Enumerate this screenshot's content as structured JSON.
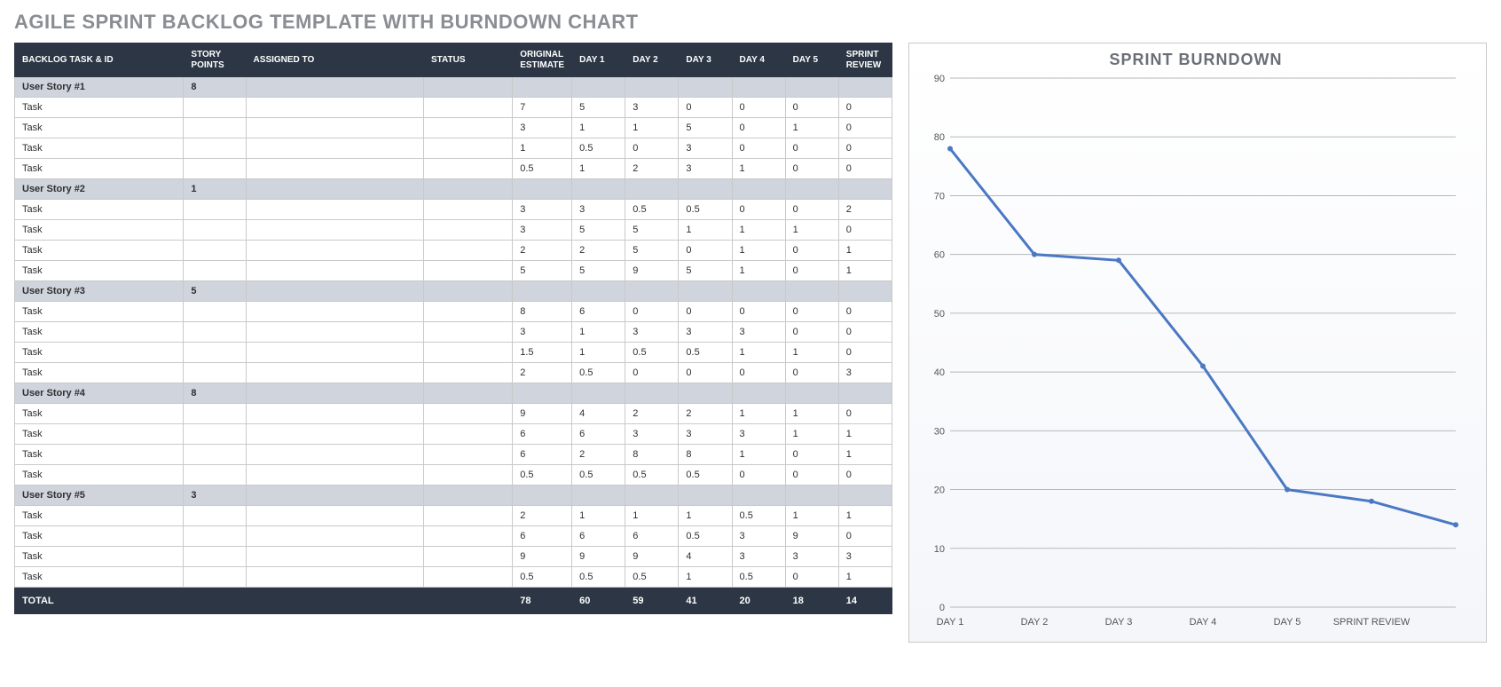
{
  "title": "AGILE SPRINT BACKLOG TEMPLATE WITH BURNDOWN CHART",
  "columns": [
    "BACKLOG TASK & ID",
    "STORY POINTS",
    "ASSIGNED TO",
    "STATUS",
    "ORIGINAL ESTIMATE",
    "DAY 1",
    "DAY 2",
    "DAY 3",
    "DAY 4",
    "DAY 5",
    "SPRINT REVIEW"
  ],
  "rows": [
    {
      "type": "story",
      "cells": [
        "User Story #1",
        "8",
        "",
        "",
        "",
        "",
        "",
        "",
        "",
        "",
        ""
      ]
    },
    {
      "type": "task",
      "cells": [
        "Task",
        "",
        "",
        "",
        "7",
        "5",
        "3",
        "0",
        "0",
        "0",
        "0"
      ]
    },
    {
      "type": "task",
      "cells": [
        "Task",
        "",
        "",
        "",
        "3",
        "1",
        "1",
        "5",
        "0",
        "1",
        "0"
      ]
    },
    {
      "type": "task",
      "cells": [
        "Task",
        "",
        "",
        "",
        "1",
        "0.5",
        "0",
        "3",
        "0",
        "0",
        "0"
      ]
    },
    {
      "type": "task",
      "cells": [
        "Task",
        "",
        "",
        "",
        "0.5",
        "1",
        "2",
        "3",
        "1",
        "0",
        "0"
      ]
    },
    {
      "type": "story",
      "cells": [
        "User Story #2",
        "1",
        "",
        "",
        "",
        "",
        "",
        "",
        "",
        "",
        ""
      ]
    },
    {
      "type": "task",
      "cells": [
        "Task",
        "",
        "",
        "",
        "3",
        "3",
        "0.5",
        "0.5",
        "0",
        "0",
        "2"
      ]
    },
    {
      "type": "task",
      "cells": [
        "Task",
        "",
        "",
        "",
        "3",
        "5",
        "5",
        "1",
        "1",
        "1",
        "0"
      ]
    },
    {
      "type": "task",
      "cells": [
        "Task",
        "",
        "",
        "",
        "2",
        "2",
        "5",
        "0",
        "1",
        "0",
        "1"
      ]
    },
    {
      "type": "task",
      "cells": [
        "Task",
        "",
        "",
        "",
        "5",
        "5",
        "9",
        "5",
        "1",
        "0",
        "1"
      ]
    },
    {
      "type": "story",
      "cells": [
        "User Story #3",
        "5",
        "",
        "",
        "",
        "",
        "",
        "",
        "",
        "",
        ""
      ]
    },
    {
      "type": "task",
      "cells": [
        "Task",
        "",
        "",
        "",
        "8",
        "6",
        "0",
        "0",
        "0",
        "0",
        "0"
      ]
    },
    {
      "type": "task",
      "cells": [
        "Task",
        "",
        "",
        "",
        "3",
        "1",
        "3",
        "3",
        "3",
        "0",
        "0"
      ]
    },
    {
      "type": "task",
      "cells": [
        "Task",
        "",
        "",
        "",
        "1.5",
        "1",
        "0.5",
        "0.5",
        "1",
        "1",
        "0"
      ]
    },
    {
      "type": "task",
      "cells": [
        "Task",
        "",
        "",
        "",
        "2",
        "0.5",
        "0",
        "0",
        "0",
        "0",
        "3"
      ]
    },
    {
      "type": "story",
      "cells": [
        "User Story #4",
        "8",
        "",
        "",
        "",
        "",
        "",
        "",
        "",
        "",
        ""
      ]
    },
    {
      "type": "task",
      "cells": [
        "Task",
        "",
        "",
        "",
        "9",
        "4",
        "2",
        "2",
        "1",
        "1",
        "0"
      ]
    },
    {
      "type": "task",
      "cells": [
        "Task",
        "",
        "",
        "",
        "6",
        "6",
        "3",
        "3",
        "3",
        "1",
        "1"
      ]
    },
    {
      "type": "task",
      "cells": [
        "Task",
        "",
        "",
        "",
        "6",
        "2",
        "8",
        "8",
        "1",
        "0",
        "1"
      ]
    },
    {
      "type": "task",
      "cells": [
        "Task",
        "",
        "",
        "",
        "0.5",
        "0.5",
        "0.5",
        "0.5",
        "0",
        "0",
        "0"
      ]
    },
    {
      "type": "story",
      "cells": [
        "User Story #5",
        "3",
        "",
        "",
        "",
        "",
        "",
        "",
        "",
        "",
        ""
      ]
    },
    {
      "type": "task",
      "cells": [
        "Task",
        "",
        "",
        "",
        "2",
        "1",
        "1",
        "1",
        "0.5",
        "1",
        "1"
      ]
    },
    {
      "type": "task",
      "cells": [
        "Task",
        "",
        "",
        "",
        "6",
        "6",
        "6",
        "0.5",
        "3",
        "9",
        "0"
      ]
    },
    {
      "type": "task",
      "cells": [
        "Task",
        "",
        "",
        "",
        "9",
        "9",
        "9",
        "4",
        "3",
        "3",
        "3"
      ]
    },
    {
      "type": "task",
      "cells": [
        "Task",
        "",
        "",
        "",
        "0.5",
        "0.5",
        "0.5",
        "1",
        "0.5",
        "0",
        "1"
      ]
    },
    {
      "type": "total",
      "cells": [
        "TOTAL",
        "",
        "",
        "",
        "78",
        "60",
        "59",
        "41",
        "20",
        "18",
        "14"
      ]
    }
  ],
  "chart_data": {
    "type": "line",
    "title": "SPRINT BURNDOWN",
    "categories": [
      "DAY 1",
      "DAY 2",
      "DAY 3",
      "DAY 4",
      "DAY 5",
      "SPRINT REVIEW"
    ],
    "values": [
      78,
      60,
      59,
      41,
      20,
      18,
      14
    ],
    "xlabel": "",
    "ylabel": "",
    "ylim": [
      0,
      90
    ],
    "yticks": [
      0,
      10,
      20,
      30,
      40,
      50,
      60,
      70,
      80,
      90
    ],
    "notes": "The line plots 7 points (one per totals column incl. a trailing point beyond SPRINT REVIEW) but the x-axis only labels 6 categories."
  }
}
